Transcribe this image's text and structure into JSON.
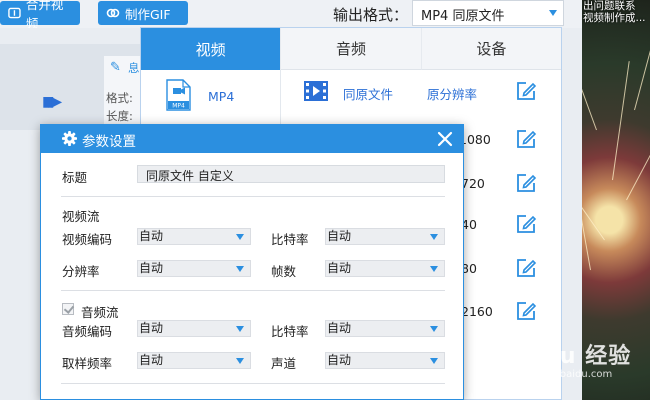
{
  "toolbar": {
    "merge_label": "合并视频",
    "gif_label": "制作GIF",
    "output_format_label": "输出格式：",
    "output_format_value": "MP4  同原文件"
  },
  "file_info": {
    "edit_text": "息",
    "format_label": "格式:",
    "length_label": "长度:"
  },
  "format_panel": {
    "tabs": [
      {
        "label": "视频",
        "active": true
      },
      {
        "label": "音频",
        "active": false
      },
      {
        "label": "设备",
        "active": false
      }
    ],
    "formats": [
      {
        "name": "MP4",
        "icon_text": "MP4"
      }
    ],
    "presets": [
      {
        "name": "同原文件",
        "resolution": "原分辨率"
      },
      {
        "resolution": "1080"
      },
      {
        "resolution": "720"
      },
      {
        "resolution": "40"
      },
      {
        "resolution": "80"
      },
      {
        "resolution": "2160"
      }
    ]
  },
  "right_image": {
    "caption_lines": [
      "出问题联系",
      "视频制作成..."
    ]
  },
  "dialog": {
    "title": "参数设置",
    "title_label": "标题",
    "title_value": "同原文件 自定义",
    "video_section": "视频流",
    "video_codec_label": "视频编码",
    "video_codec_value": "自动",
    "video_bitrate_label": "比特率",
    "video_bitrate_value": "自动",
    "resolution_label": "分辨率",
    "resolution_value": "自动",
    "framerate_label": "帧数",
    "framerate_value": "自动",
    "audio_section": "音频流",
    "audio_enabled": true,
    "audio_codec_label": "音频编码",
    "audio_codec_value": "自动",
    "audio_bitrate_label": "比特率",
    "audio_bitrate_value": "自动",
    "samplerate_label": "取样频率",
    "samplerate_value": "自动",
    "channel_label": "声道",
    "channel_value": "自动"
  },
  "watermark": {
    "main": "Baidu 经验",
    "sub": "jingyan.baidu.com"
  },
  "colors": {
    "accent": "#2b8fe0",
    "panel_bg": "#ffffff",
    "app_bg": "#e9edf2"
  }
}
